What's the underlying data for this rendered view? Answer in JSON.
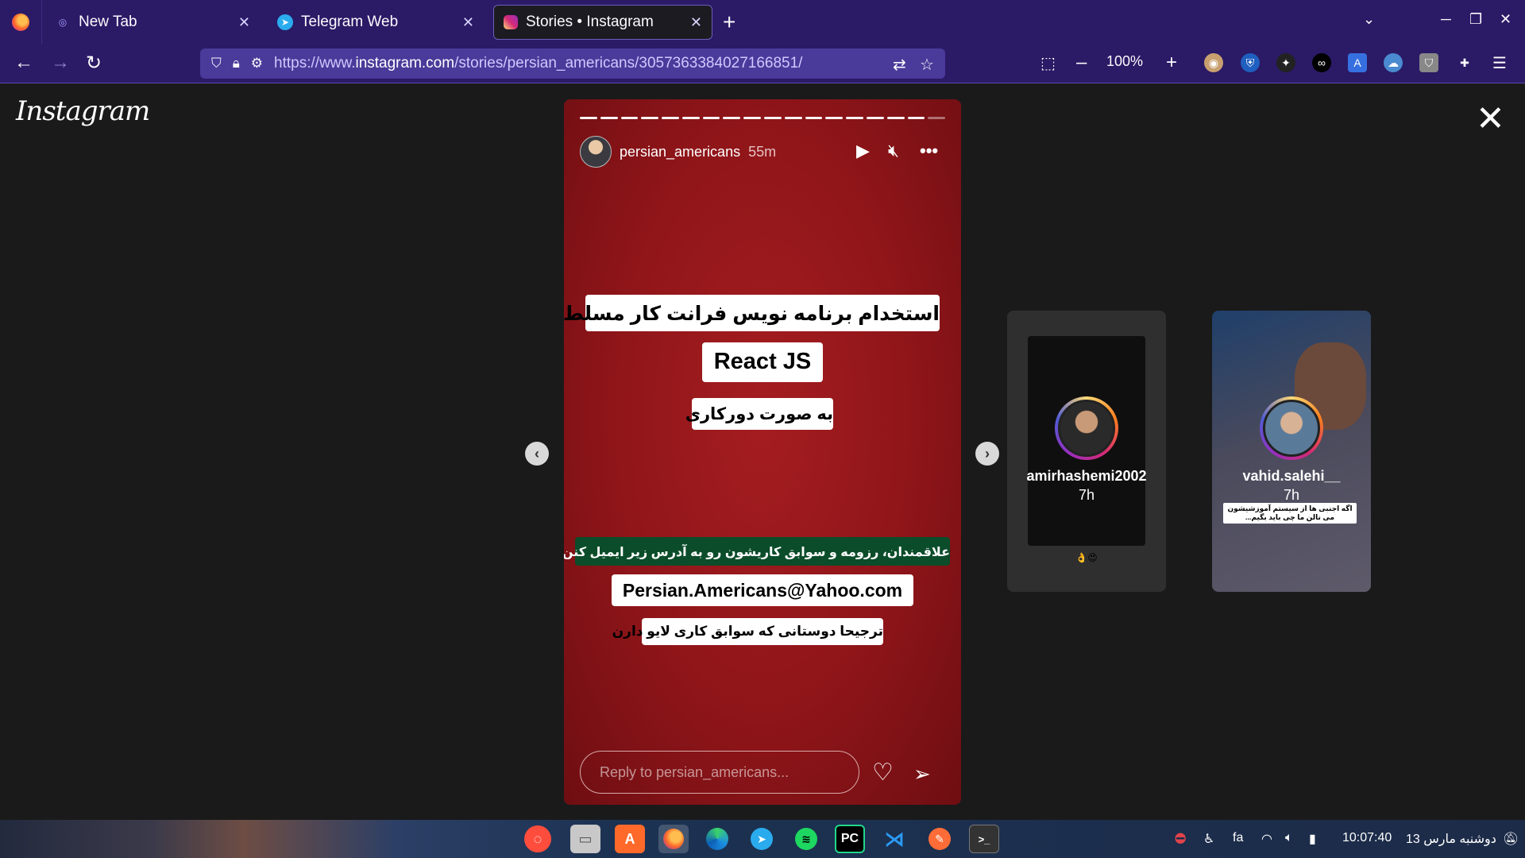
{
  "browser": {
    "tabs": [
      {
        "label": "New Tab",
        "icon": "new-tab-icon"
      },
      {
        "label": "Telegram Web",
        "icon": "telegram-icon"
      },
      {
        "label": "Stories • Instagram",
        "icon": "instagram-icon",
        "active": true
      }
    ],
    "url_prefix": "https://www.",
    "url_domain": "instagram.com",
    "url_path": "/stories/persian_americans/3057363384027166851/",
    "zoom": "100%"
  },
  "page": {
    "logo": "Instagram",
    "story": {
      "username": "persian_americans",
      "time": "55m",
      "segments": 18,
      "line1": "استخدام برنامه نویس فرانت کار مسلط به",
      "line2": "React JS",
      "line3": "به صورت دورکاری",
      "line4": "علاقمندان، رزومه و سوابق کاریشون رو به آدرس زیر ایمیل کنن",
      "line5": "Persian.Americans@Yahoo.com",
      "line6": "ترجیحا دوستانی که سوابق کاری لایو دارن",
      "reply_placeholder": "Reply to persian_americans..."
    },
    "previews": [
      {
        "username": "amirhashemi2002",
        "time": "7h",
        "caption": "👌😍"
      },
      {
        "username": "vahid.salehi__",
        "time": "7h",
        "caption": "اگه اجنبی ها از سیستم آموزشیشون می نالن ما چی باید بگیم..."
      }
    ]
  },
  "taskbar": {
    "lang": "fa",
    "time": "10:07:40",
    "date": "دوشنبه مارس 13"
  },
  "colors": {
    "chrome": "#2b1a66",
    "story_bg": "#a51d20",
    "sticker_green": "#0b4d2a"
  }
}
